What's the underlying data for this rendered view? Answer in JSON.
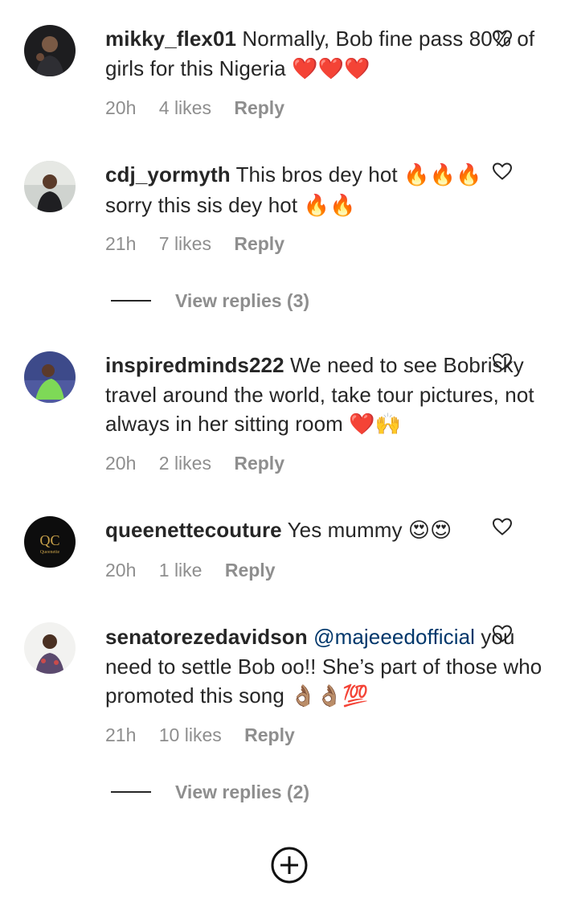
{
  "comments": [
    {
      "username": "mikky_flex01",
      "text_before": " Normally, Bob fine pass 80% of girls for this Nigeria ",
      "emoji": "❤️❤️❤️",
      "time": "20h",
      "likes": "4 likes",
      "reply": "Reply"
    },
    {
      "username": "cdj_yormyth",
      "line1": " This bros dey hot ",
      "emoji1": "🔥🔥🔥",
      "line2": "sorry this sis dey hot ",
      "emoji2": "🔥🔥",
      "time": "21h",
      "likes": "7 likes",
      "reply": "Reply"
    },
    {
      "username": "inspiredminds222",
      "text_before": " We need to see Bobrisky travel around the world, take tour pictures, not always in her sitting room ",
      "emoji": "❤️🙌",
      "time": "20h",
      "likes": "2 likes",
      "reply": "Reply"
    },
    {
      "username": "queenettecouture",
      "text_before": " Yes mummy ",
      "emoji": "😍😍",
      "time": "20h",
      "likes": "1 like",
      "reply": "Reply",
      "avatar_letters": "QC",
      "avatar_sub": "Queenette"
    },
    {
      "username": "senatorezedavidson",
      "mention": " @majeeedofficial",
      "text_after": " you need to settle Bob oo!! She’s part of those who promoted this song ",
      "emoji": "👌🏽👌🏽💯",
      "time": "21h",
      "likes": "10 likes",
      "reply": "Reply"
    }
  ],
  "view_replies_1": "View replies (3)",
  "view_replies_2": "View replies (2)",
  "colors": {
    "text": "#262626",
    "secondary": "#8e8e8e",
    "mention": "#00376b"
  }
}
